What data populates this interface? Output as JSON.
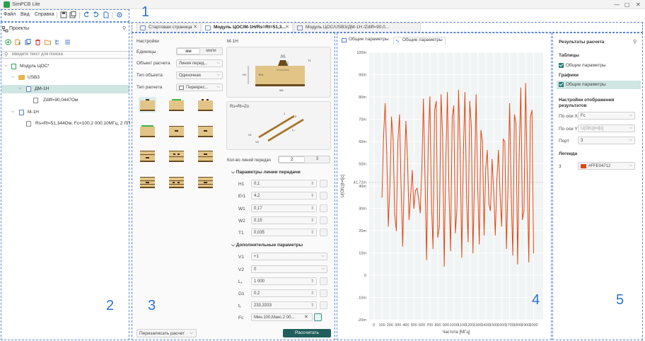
{
  "app": {
    "title": "SimPCB Lite"
  },
  "menu": {
    "file": "Файл",
    "view": "Вид",
    "help": "Справка"
  },
  "tabs": [
    {
      "label": "Стартовая страница"
    },
    {
      "label": "Модуль ЦОС/М-1Н/Rs=Rt=51,3..."
    },
    {
      "label": "Модуль ЦОС/USB3/ДМ-1Н /Zdiff=90,0..."
    }
  ],
  "projects": {
    "title": "Проекты",
    "search_placeholder": "Введите текст для поиска",
    "tree": [
      {
        "label": "Модуль ЦОС*"
      },
      {
        "label": "USB3"
      },
      {
        "label": "ДМ-1Н"
      },
      {
        "label": "Zdiff=90,0447Ом"
      },
      {
        "label": "М-1Н"
      },
      {
        "label": "Rs=Rl=51,344Ом, Fc=100;2 000;10МГц, 2 ЛП"
      }
    ]
  },
  "settings": {
    "title": "Настройки",
    "units_label": "Единицы",
    "units_opt1": "мм",
    "units_opt2": "мили",
    "object_label": "Объект расчета",
    "object_value": "Линия перед...",
    "objtype_label": "Тип объекта",
    "objtype_value": "Одиночная",
    "calctype_label": "Тип расчета",
    "calctype_value": "Перекрес...",
    "model_title": "М-1Н",
    "diagram": {
      "w2": "W2",
      "t1": "T1",
      "h1": "H1",
      "er1": "Er1",
      "w1": "W1"
    },
    "eq_label": "Rs=Rl=Zo",
    "line_diagram": {
      "v1": "V1",
      "v2": "V2",
      "len": "L₁",
      "p1": "1",
      "p2": "2"
    },
    "lines_count_label": "Кол-во линий передач",
    "lines_count_opt1": "2",
    "lines_count_opt2": "3",
    "section_tl": "Параметры линии передачи",
    "params": [
      {
        "name": "H1",
        "value": "0,1"
      },
      {
        "name": "Er1",
        "value": "4,2"
      },
      {
        "name": "W1",
        "value": "0,17"
      },
      {
        "name": "W2",
        "value": "0,15"
      },
      {
        "name": "T1",
        "value": "0,035"
      }
    ],
    "section_extra": "Дополнительные параметры",
    "extra": [
      {
        "name": "V1",
        "value": "+1"
      },
      {
        "name": "V2",
        "value": "0"
      },
      {
        "name": "L₁",
        "value": "1 000"
      },
      {
        "name": "G1",
        "value": "0,2"
      },
      {
        "name": "t₁",
        "value": "233,3333"
      },
      {
        "name": "Fc",
        "value": "Мин.100,Макс.2 00..."
      }
    ],
    "recalc_label": "Перезаписать расчет",
    "calc_label": "Рассчитать"
  },
  "plot": {
    "tab1": "Общие параметры",
    "tab2": "Общие параметры"
  },
  "chart_data": {
    "type": "line",
    "xlabel": "Частота [МГц]",
    "ylabel": "U(Ofc)|t=t[c]",
    "xlim": [
      -60,
      2120
    ],
    "ylim": [
      -0.02,
      0.1
    ],
    "xticks": [
      0,
      100,
      200,
      300,
      400,
      500,
      600,
      700,
      800,
      900,
      1000,
      1100,
      1200,
      1300,
      1400,
      1500,
      1600,
      1700,
      1800,
      1900,
      2000
    ],
    "xtick_labels": [
      "0",
      "100",
      "200",
      "300",
      "400",
      "500",
      "600",
      "700",
      "800",
      "900",
      "1000",
      "1100",
      "1200",
      "1300",
      "1400",
      "1500",
      "1600",
      "1700",
      "1800",
      "1900",
      "2000"
    ],
    "yticks": [
      -0.02,
      -0.01,
      0,
      0.01,
      0.02,
      0.03,
      0.04,
      0.05,
      0.06,
      0.07,
      0.08,
      0.09,
      0.1
    ],
    "ytick_labels": [
      "-20m",
      "-10m",
      "0",
      "10m",
      "20m",
      "30m",
      "40m",
      "50m",
      "60m",
      "70m",
      "80m",
      "90m",
      "100m"
    ],
    "marker_value": 0.04172,
    "marker_label": "41,72m",
    "series": [
      {
        "color": "#E04712",
        "x": [
          100,
          120,
          140,
          160,
          180,
          200,
          220,
          240,
          260,
          280,
          300,
          320,
          340,
          360,
          380,
          400,
          420,
          440,
          460,
          480,
          500,
          520,
          540,
          560,
          580,
          600,
          620,
          640,
          660,
          680,
          700,
          720,
          740,
          760,
          780,
          800,
          820,
          840,
          860,
          880,
          900,
          920,
          940,
          960,
          980,
          1000,
          1020,
          1040,
          1060,
          1080,
          1100,
          1120,
          1140,
          1160,
          1180,
          1200,
          1220,
          1240,
          1260,
          1280,
          1300,
          1320,
          1340,
          1360,
          1380,
          1400,
          1420,
          1440,
          1460,
          1480,
          1500,
          1520,
          1540,
          1560,
          1580,
          1600,
          1620,
          1640,
          1660,
          1680,
          1700,
          1720,
          1740,
          1760,
          1780,
          1800,
          1820,
          1840,
          1860,
          1880,
          1900,
          1920,
          1940,
          1960,
          1980,
          2000
        ],
        "y": [
          0.035,
          0.062,
          0.077,
          0.055,
          0.022,
          0.04,
          0.071,
          0.061,
          0.027,
          0.02,
          0.06,
          0.072,
          0.04,
          0.013,
          0.045,
          0.069,
          0.052,
          0.025,
          0.036,
          0.047,
          0.03,
          0.038,
          0.039,
          0.034,
          0.028,
          0.048,
          0.079,
          0.043,
          0.007,
          0.059,
          0.08,
          0.033,
          0.012,
          0.074,
          0.078,
          0.017,
          0.022,
          0.081,
          0.063,
          0.004,
          0.05,
          0.082,
          0.038,
          0.011,
          0.071,
          0.076,
          0.019,
          0.03,
          0.083,
          0.057,
          0.008,
          0.055,
          0.082,
          0.035,
          0.015,
          0.078,
          0.067,
          0.01,
          0.044,
          0.081,
          0.039,
          0.014,
          0.065,
          0.06,
          0.018,
          0.048,
          0.056,
          0.032,
          0.029,
          0.052,
          0.038,
          0.018,
          0.043,
          0.056,
          0.036,
          0.022,
          0.061,
          0.06,
          0.012,
          0.04,
          0.077,
          0.035,
          0.009,
          0.072,
          0.068,
          0.005,
          0.054,
          0.084,
          0.025,
          0.029,
          0.086,
          0.046,
          0.006,
          0.071,
          0.074,
          0.01
        ]
      }
    ]
  },
  "results": {
    "title": "Результаты расчета",
    "tables_h": "Таблицы",
    "tables_item": "Общие параметры",
    "graphs_h": "Графики",
    "graphs_item": "Общие параметры",
    "display_h1": "Настройки отображения",
    "display_h2": "результатов",
    "xaxis_label": "По оси X",
    "xaxis_value": "Fc",
    "yaxis_label": "По оси Y",
    "yaxis_value": "U(Ofc)|t=t[c]",
    "port_label": "Порт",
    "port_value": "3",
    "legend_h": "Легенда",
    "legend_port": "3",
    "legend_color": "#FFE04712",
    "legend_swatch": "#E04712"
  },
  "annotations": [
    "1",
    "2",
    "3",
    "4",
    "5"
  ]
}
